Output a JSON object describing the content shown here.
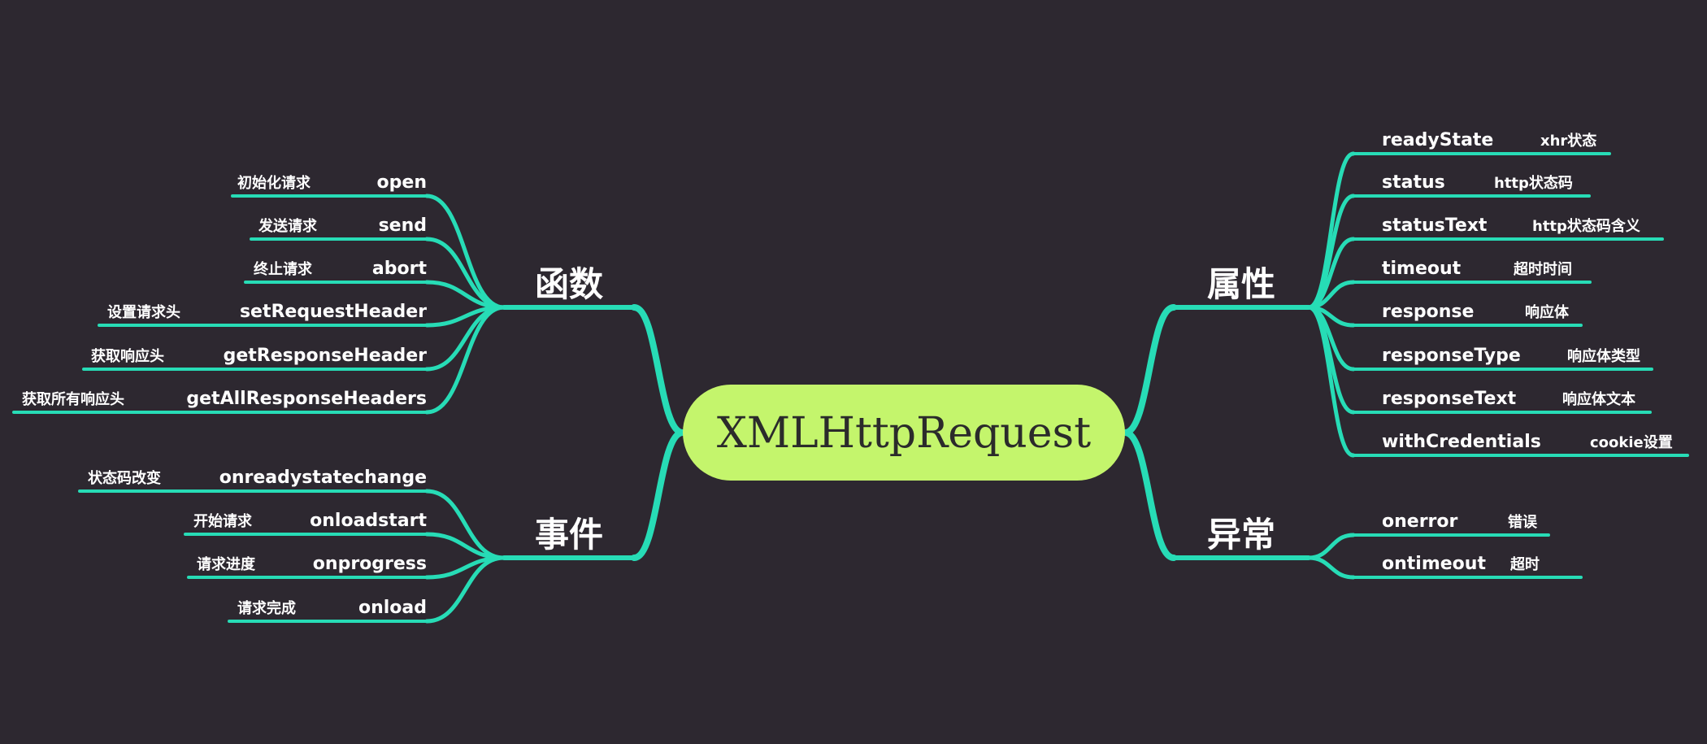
{
  "center": {
    "label": "XMLHttpRequest"
  },
  "accent_color": "#27dcb6",
  "center_color": "#c4f56c",
  "background_color": "#2d2830",
  "branches": {
    "functions": {
      "label": "函数",
      "items": [
        {
          "name": "open",
          "note": "初始化请求"
        },
        {
          "name": "send",
          "note": "发送请求"
        },
        {
          "name": "abort",
          "note": "终止请求"
        },
        {
          "name": "setRequestHeader",
          "note": "设置请求头"
        },
        {
          "name": "getResponseHeader",
          "note": "获取响应头"
        },
        {
          "name": "getAllResponseHeaders",
          "note": "获取所有响应头"
        }
      ]
    },
    "events": {
      "label": "事件",
      "items": [
        {
          "name": "onreadystatechange",
          "note": "状态码改变"
        },
        {
          "name": "onloadstart",
          "note": "开始请求"
        },
        {
          "name": "onprogress",
          "note": "请求进度"
        },
        {
          "name": "onload",
          "note": "请求完成"
        }
      ]
    },
    "properties": {
      "label": "属性",
      "items": [
        {
          "name": "readyState",
          "note": "xhr状态"
        },
        {
          "name": "status",
          "note": "http状态码"
        },
        {
          "name": "statusText",
          "note": "http状态码含义"
        },
        {
          "name": "timeout",
          "note": "超时时间"
        },
        {
          "name": "response",
          "note": "响应体"
        },
        {
          "name": "responseType",
          "note": "响应体类型"
        },
        {
          "name": "responseText",
          "note": "响应体文本"
        },
        {
          "name": "withCredentials",
          "note": "cookie设置"
        }
      ]
    },
    "exceptions": {
      "label": "异常",
      "items": [
        {
          "name": "onerror",
          "note": "错误"
        },
        {
          "name": "ontimeout",
          "note": "超时"
        }
      ]
    }
  }
}
